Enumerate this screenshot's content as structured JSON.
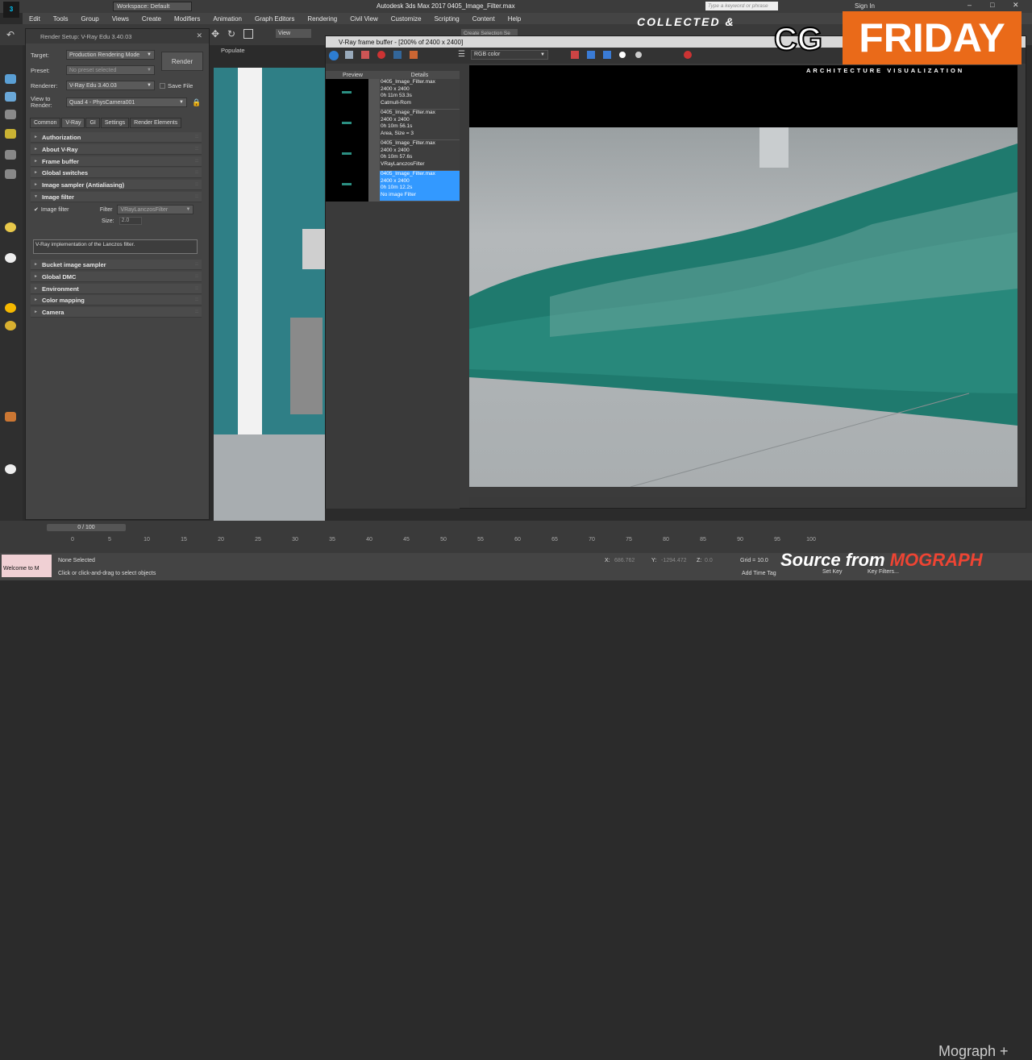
{
  "window": {
    "workspace_label": "Workspace: Default",
    "title": "Autodesk 3ds Max 2017   0405_Image_Filter.max",
    "search_placeholder": "Type a keyword or phrase",
    "sign_in": "Sign In"
  },
  "menu": [
    "Edit",
    "Tools",
    "Group",
    "Views",
    "Create",
    "Modifiers",
    "Animation",
    "Graph Editors",
    "Rendering",
    "Civil View",
    "Customize",
    "Scripting",
    "Content",
    "Help"
  ],
  "toolbar": {
    "view_label": "View",
    "selection_set_label": "Create Selection Se",
    "populate_label": "Populate"
  },
  "render_setup": {
    "title": "Render Setup: V-Ray Edu 3.40.03",
    "target_label": "Target:",
    "target_value": "Production Rendering Mode",
    "preset_label": "Preset:",
    "preset_value": "No preset selected",
    "renderer_label": "Renderer:",
    "renderer_value": "V-Ray Edu 3.40.03",
    "save_file_label": "Save File",
    "view_label": "View to Render:",
    "view_value": "Quad 4 - PhysCamera001",
    "render_button": "Render",
    "tabs": [
      "Common",
      "V-Ray",
      "GI",
      "Settings",
      "Render Elements"
    ],
    "rollouts_top": [
      "Authorization",
      "About V-Ray",
      "Frame buffer",
      "Global switches",
      "Image sampler (Antialiasing)",
      "Image filter"
    ],
    "image_filter_label": "Image filter",
    "filter_label": "Filter",
    "filter_value": "VRayLanczosFilter",
    "size_label": "Size:",
    "size_value": "2.0",
    "description": "V-Ray implementation of the Lanczos filter.",
    "rollouts_bottom": [
      "Bucket image sampler",
      "Global DMC",
      "Environment",
      "Color mapping",
      "Camera"
    ]
  },
  "vfb": {
    "title": "V-Ray frame buffer - [200% of 2400 x 2400]",
    "channel": "RGB color",
    "history_headers": [
      "Preview",
      "Details"
    ],
    "history": [
      {
        "line1": "0405_Image_Filter.max",
        "line2": "2400 x 2400",
        "line3": "0h 11m 53.3s",
        "line4": "Catmull-Rom"
      },
      {
        "line1": "0405_Image_Filter.max",
        "line2": "2400 x 2400",
        "line3": "0h 10m 56.1s",
        "line4": "Area, Size = 3"
      },
      {
        "line1": "0405_Image_Filter.max",
        "line2": "2400 x 2400",
        "line3": "0h 10m 57.6s",
        "line4": "VRayLanczosFilter"
      },
      {
        "line1": "0405_Image_Filter.max",
        "line2": "2400 x 2400",
        "line3": "0h 10m 12.2s",
        "line4": "No image Filter"
      }
    ],
    "selected_index": 3
  },
  "timeline": {
    "frame_label": "0 / 100",
    "ticks": [
      "0",
      "5",
      "10",
      "15",
      "20",
      "25",
      "30",
      "35",
      "40",
      "45",
      "50",
      "55",
      "60",
      "65",
      "70",
      "75",
      "80",
      "85",
      "90",
      "95",
      "100"
    ]
  },
  "status": {
    "maxscript": "Welcome to M",
    "selection": "None Selected",
    "hint": "Click or click-and-drag to select objects",
    "x_label": "X:",
    "x_value": "686.762",
    "y_label": "Y:",
    "y_value": "-1294.472",
    "z_label": "Z:",
    "z_value": "0.0",
    "grid": "Grid = 10.0",
    "add_time_tag": "Add Time Tag",
    "set_key": "Set Key",
    "key_filters": "Key Filters..."
  },
  "overlay": {
    "collected": "COLLECTED &",
    "cg": "CG",
    "friday": "FRIDAY",
    "architecture": "ARCHITECTURE VISUALIZATION",
    "source_from": "Source from",
    "source_brand": "MOGRAPH",
    "mograph": "Mograph +"
  },
  "colors": {
    "accent_orange": "#ea6a19",
    "selection_blue": "#3399ff",
    "grass_teal": "#1f7a6e"
  }
}
